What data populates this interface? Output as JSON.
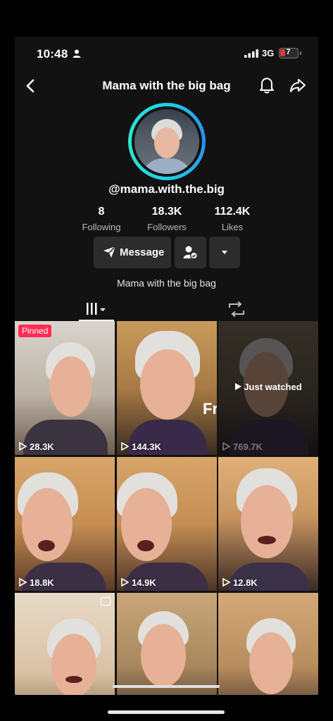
{
  "status_bar": {
    "time": "10:48",
    "network": "3G",
    "battery_level": "7",
    "icons": [
      "person-icon",
      "signal-icon",
      "battery-icon"
    ]
  },
  "nav": {
    "title": "Mama with the big bag",
    "icons": [
      "back-arrow-icon",
      "bell-icon",
      "share-icon"
    ]
  },
  "profile": {
    "handle": "@mama.with.the.big",
    "stats": [
      {
        "value": "8",
        "label": "Following"
      },
      {
        "value": "18.3K",
        "label": "Followers"
      },
      {
        "value": "112.4K",
        "label": "Likes"
      }
    ],
    "message_label": "Message",
    "bio": "Mama with the big bag",
    "ring_colors": [
      "#1fd1e8",
      "#2a8cf0"
    ]
  },
  "tabs": {
    "active": "videos-grid",
    "icons": [
      "grid-icon",
      "repost-icon"
    ]
  },
  "videos": [
    {
      "views": "28.3K",
      "pinned_label": "Pinned"
    },
    {
      "views": "144.3K",
      "overlay_text": "Fr"
    },
    {
      "views": "769.7K",
      "status": "Just watched"
    },
    {
      "views": "18.8K"
    },
    {
      "views": "14.9K"
    },
    {
      "views": "12.8K"
    },
    {
      "views": ""
    },
    {
      "views": ""
    },
    {
      "views": ""
    }
  ],
  "colors": {
    "background": "#121212",
    "pinned_badge": "#fe2c55",
    "button_bg": "#2c2c2c"
  }
}
